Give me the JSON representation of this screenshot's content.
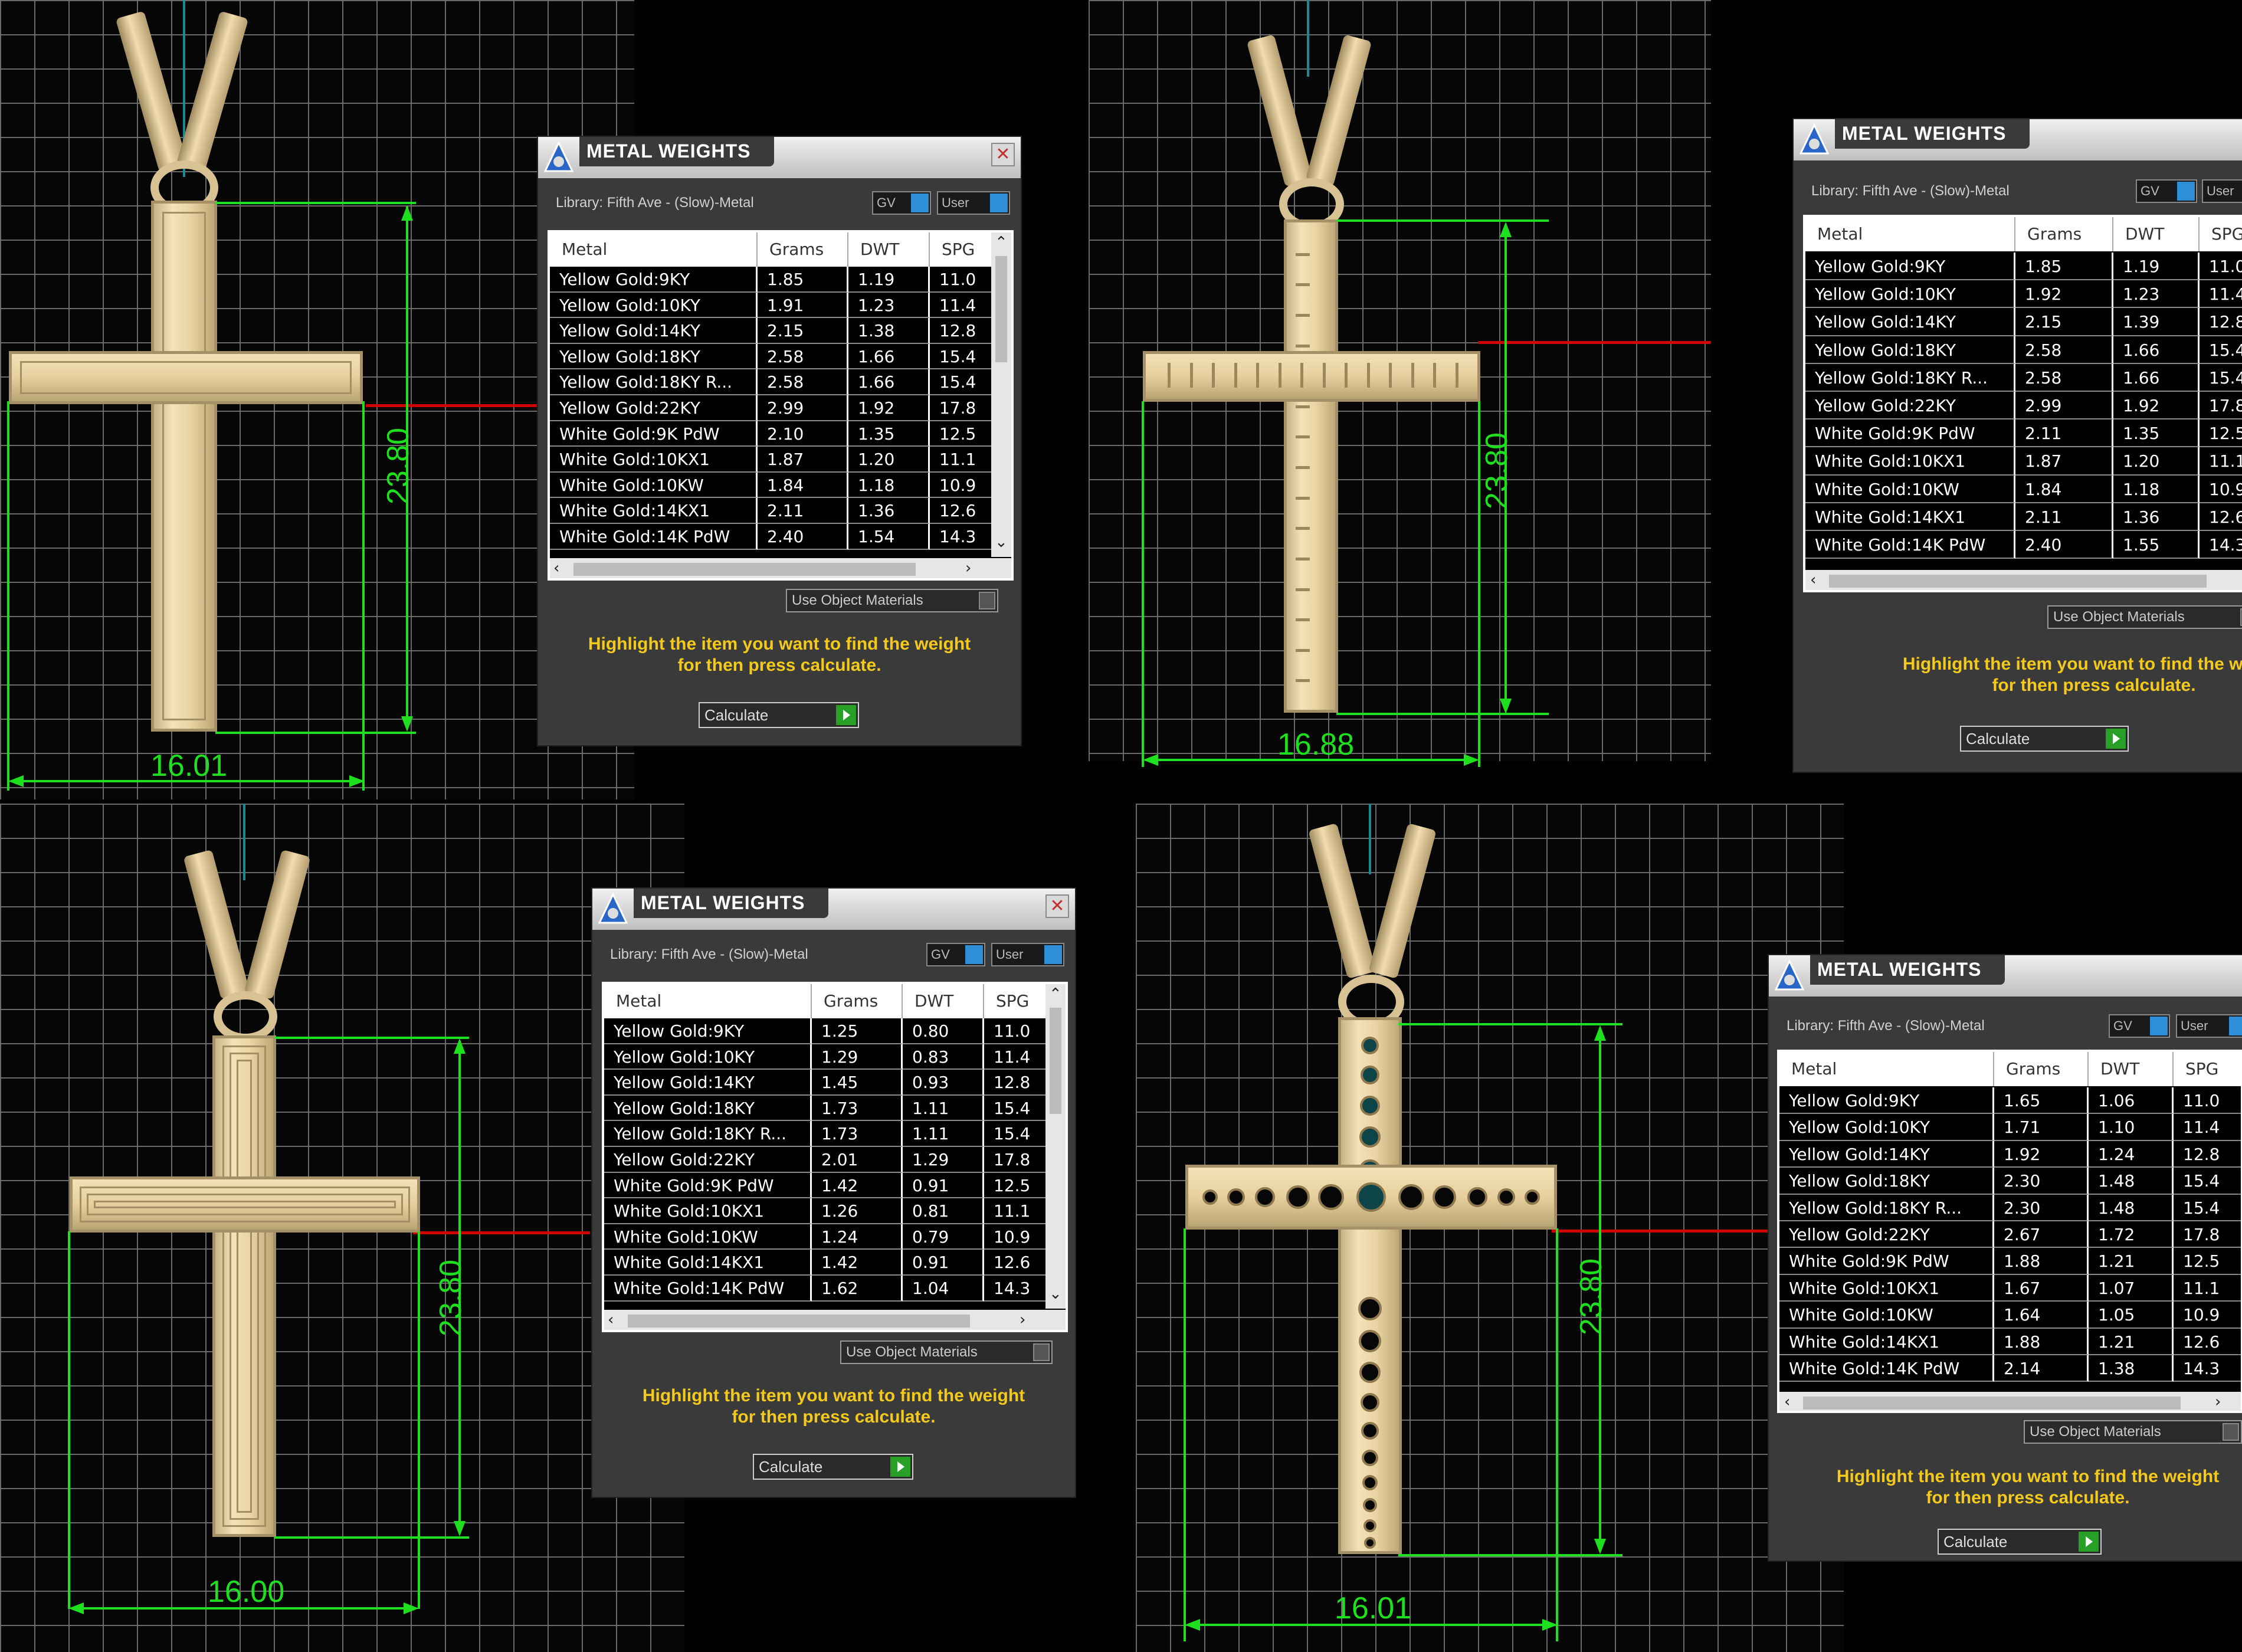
{
  "dialog": {
    "title": "METAL WEIGHTS",
    "library": "Library: Fifth Ave - (Slow)-Metal",
    "gv_label": "GV",
    "user_label": "User",
    "columns": [
      "Metal",
      "Grams",
      "DWT",
      "SPG"
    ],
    "use_object_materials": "Use Object Materials",
    "hint_line1": "Highlight the item you want to find the weight",
    "hint_line2": "for then press calculate.",
    "calculate_label": "Calculate",
    "close_glyph": "✕"
  },
  "metals": [
    "Yellow Gold:9KY",
    "Yellow Gold:10KY",
    "Yellow Gold:14KY",
    "Yellow Gold:18KY",
    "Yellow Gold:18KY R...",
    "Yellow Gold:22KY",
    "White Gold:9K PdW",
    "White Gold:10KX1",
    "White Gold:10KW",
    "White Gold:14KX1",
    "White Gold:14K PdW"
  ],
  "spg_visible": [
    "11.0",
    "11.4",
    "12.8",
    "15.4",
    "15.4",
    "17.8",
    "12.5",
    "11.1",
    "10.9",
    "12.6",
    "14.3"
  ],
  "panels": [
    {
      "id": "top-left",
      "width_label": "16.01",
      "height_label": "23.80",
      "grams": [
        "1.85",
        "1.91",
        "2.15",
        "2.58",
        "2.58",
        "2.99",
        "2.10",
        "1.87",
        "1.84",
        "2.11",
        "2.40"
      ],
      "dwt": [
        "1.19",
        "1.23",
        "1.38",
        "1.66",
        "1.66",
        "1.92",
        "1.35",
        "1.20",
        "1.18",
        "1.36",
        "1.54"
      ]
    },
    {
      "id": "top-right",
      "width_label": "16.88",
      "height_label": "23.80",
      "grams": [
        "1.85",
        "1.92",
        "2.15",
        "2.58",
        "2.58",
        "2.99",
        "2.11",
        "1.87",
        "1.84",
        "2.11",
        "2.40"
      ],
      "dwt": [
        "1.19",
        "1.23",
        "1.39",
        "1.66",
        "1.66",
        "1.92",
        "1.35",
        "1.20",
        "1.18",
        "1.36",
        "1.55"
      ]
    },
    {
      "id": "bottom-left",
      "width_label": "16.00",
      "height_label": "23.80",
      "grams": [
        "1.25",
        "1.29",
        "1.45",
        "1.73",
        "1.73",
        "2.01",
        "1.42",
        "1.26",
        "1.24",
        "1.42",
        "1.62"
      ],
      "dwt": [
        "0.80",
        "0.83",
        "0.93",
        "1.11",
        "1.11",
        "1.29",
        "0.91",
        "0.81",
        "0.79",
        "0.91",
        "1.04"
      ]
    },
    {
      "id": "bottom-right",
      "width_label": "16.01",
      "height_label": "23.80",
      "grams": [
        "1.65",
        "1.71",
        "1.92",
        "2.30",
        "2.30",
        "2.67",
        "1.88",
        "1.67",
        "1.64",
        "1.88",
        "2.14"
      ],
      "dwt": [
        "1.06",
        "1.10",
        "1.24",
        "1.48",
        "1.48",
        "1.72",
        "1.21",
        "1.07",
        "1.05",
        "1.21",
        "1.38"
      ]
    }
  ]
}
